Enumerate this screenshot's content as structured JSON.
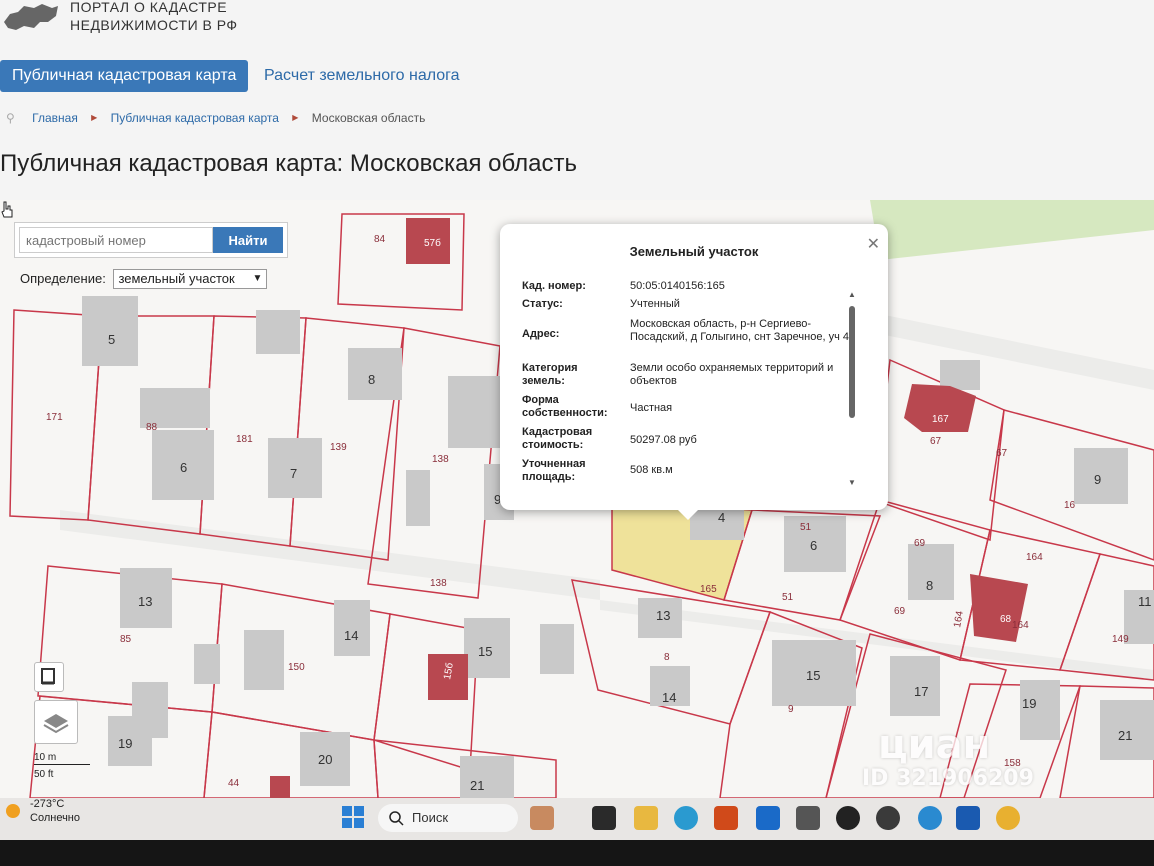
{
  "brand": {
    "line1": "ПОРТАЛ О КАДАСТРЕ",
    "line2": "НЕДВИЖИМОСТИ В РФ",
    "logo_icon": "russia-map-icon"
  },
  "nav": {
    "tabs": [
      {
        "label": "Публичная кадастровая карта",
        "active": true
      },
      {
        "label": "Расчет земельного налога",
        "active": false
      }
    ]
  },
  "breadcrumb": {
    "items": [
      "Главная",
      "Публичная кадастровая карта",
      "Московская область"
    ]
  },
  "page_title": "Публичная кадастровая карта: Московская область",
  "map": {
    "search_placeholder": "кадастровый номер",
    "search_button": "Найти",
    "definition_label": "Определение:",
    "definition_value": "земельный участок",
    "parcel_labels": [
      "84",
      "57б",
      "5",
      "171",
      "88",
      "181",
      "6",
      "7",
      "139",
      "8",
      "138",
      "138",
      "9",
      "13",
      "85",
      "14",
      "150",
      "15",
      "15б",
      "19",
      "17",
      "20",
      "44",
      "21",
      "13",
      "8",
      "14",
      "15",
      "9",
      "17",
      "19",
      "21",
      "165",
      "4",
      "51",
      "6",
      "51",
      "167",
      "67",
      "67",
      "9",
      "16",
      "69",
      "69",
      "8",
      "164",
      "164",
      "68",
      "164",
      "149",
      "11",
      "158",
      "158"
    ],
    "scale_top": "10 m",
    "scale_bottom": "50 ft",
    "colors": {
      "parcel_line": "#c8384a",
      "building": "#c9c9c9",
      "registered_building": "#b84850",
      "selected_parcel": "#efe29a",
      "green": "#d6e8c0"
    }
  },
  "popup": {
    "title": "Земельный участок",
    "rows": [
      {
        "label": "Кад. номер:",
        "value": "50:05:0140156:165"
      },
      {
        "label": "Статус:",
        "value": "Учтенный"
      },
      {
        "label": "Адрес:",
        "value": "Московская область, р-н Сергиево-Посадский, д Голыгино, снт Заречное, уч 4"
      },
      {
        "label": "Категория земель:",
        "value": "Земли особо охраняемых территорий и объектов"
      },
      {
        "label": "Форма собственности:",
        "value": "Частная"
      },
      {
        "label": "Кадастровая стоимость:",
        "value": "50297.08 руб"
      },
      {
        "label": "Уточненная площадь:",
        "value": "508 кв.м"
      }
    ]
  },
  "taskbar": {
    "weather_temp": "-273°C",
    "weather_desc": "Солнечно",
    "search_label": "Поиск"
  },
  "watermark": {
    "brand": "циан",
    "id": "ID 321906209"
  }
}
